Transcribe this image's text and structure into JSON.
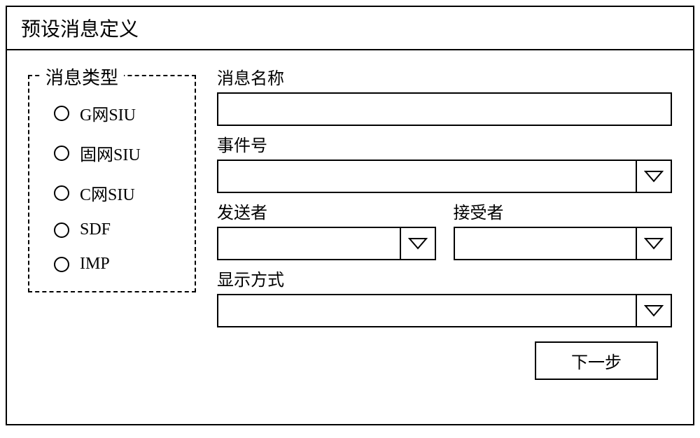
{
  "window": {
    "title": "预设消息定义"
  },
  "message_type": {
    "legend": "消息类型",
    "options": [
      "G网SIU",
      "固网SIU",
      "C网SIU",
      "SDF",
      "IMP"
    ]
  },
  "fields": {
    "message_name": {
      "label": "消息名称",
      "value": ""
    },
    "event_number": {
      "label": "事件号",
      "value": ""
    },
    "sender": {
      "label": "发送者",
      "value": ""
    },
    "receiver": {
      "label": "接受者",
      "value": ""
    },
    "display_mode": {
      "label": "显示方式",
      "value": ""
    }
  },
  "buttons": {
    "next": "下一步"
  }
}
